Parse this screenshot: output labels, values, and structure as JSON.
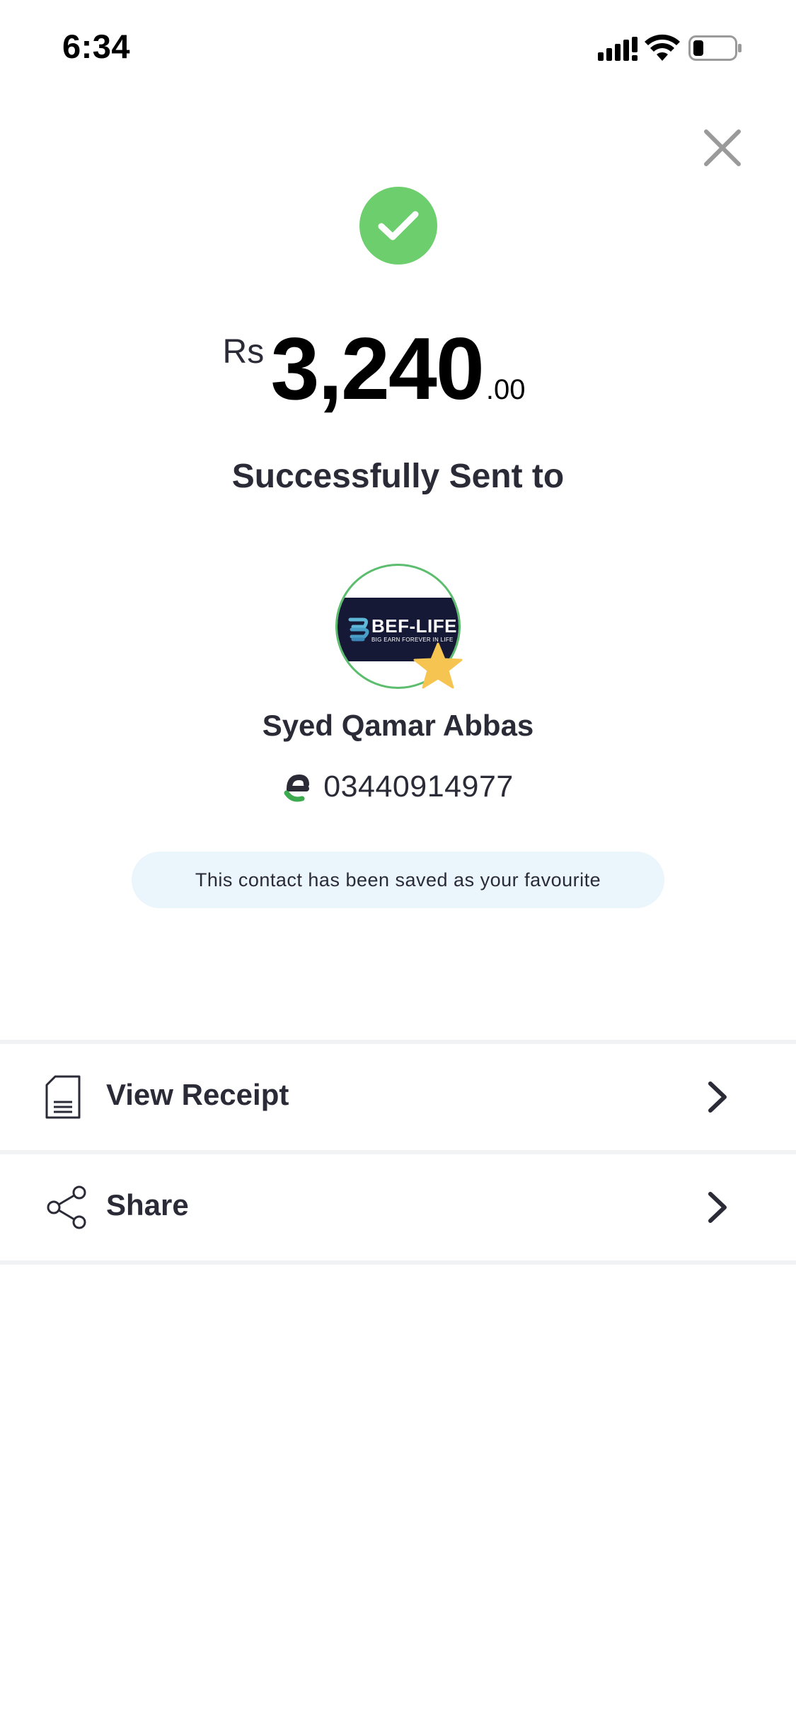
{
  "status_bar": {
    "time": "6:34",
    "icons": [
      "signal-icon",
      "wifi-icon",
      "battery-icon"
    ],
    "battery_level": 0.25
  },
  "close_icon": "close-icon",
  "success_icon": "check-circle-icon",
  "amount": {
    "currency": "Rs",
    "whole": "3,240",
    "decimal": ".00"
  },
  "sent_title": "Successfully Sent to",
  "contact": {
    "avatar_logo": "BEF-LIFE",
    "avatar_tagline": "BIG EARN FOREVER IN LIFE",
    "is_favourite": true,
    "name": "Syed Qamar Abbas",
    "wallet_icon": "easypaisa-logo-icon",
    "number": "03440914977"
  },
  "favourite_notice": "This contact has been saved as your favourite",
  "actions": [
    {
      "label": "View Receipt",
      "icon": "receipt-icon"
    },
    {
      "label": "Share",
      "icon": "share-icon"
    }
  ],
  "colors": {
    "success": "#6cce6c",
    "avatar_border": "#5bbd6d",
    "star": "#f5c451",
    "banner_bg": "#eaf5fc",
    "text": "#2b2b38"
  }
}
